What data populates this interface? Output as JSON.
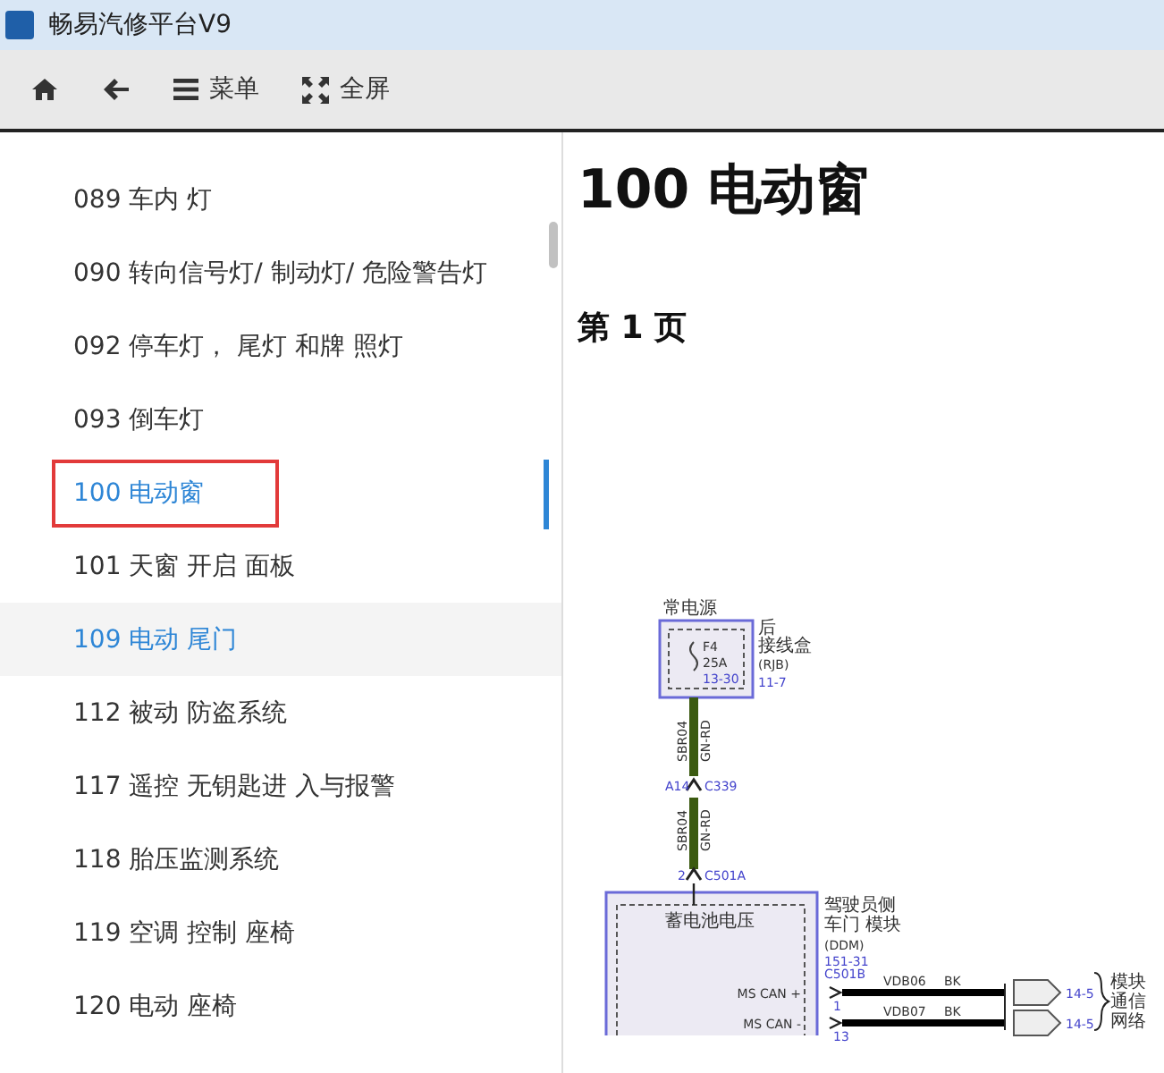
{
  "window": {
    "title": "畅易汽修平台V9"
  },
  "toolbar": [
    {
      "kind": "home"
    },
    {
      "kind": "back"
    },
    {
      "kind": "menu",
      "label": "菜单"
    },
    {
      "kind": "fullscreen",
      "label": "全屏"
    }
  ],
  "sidebar": {
    "items": [
      {
        "label": "089 车内 灯",
        "selected": false,
        "highlighted": false,
        "annotated": false
      },
      {
        "label": "090 转向信号灯/ 制动灯/ 危险警告灯",
        "selected": false,
        "highlighted": false,
        "annotated": false
      },
      {
        "label": "092 停车灯， 尾灯 和牌 照灯",
        "selected": false,
        "highlighted": false,
        "annotated": false
      },
      {
        "label": "093 倒车灯",
        "selected": false,
        "highlighted": false,
        "annotated": false
      },
      {
        "label": "100 电动窗",
        "selected": true,
        "highlighted": false,
        "annotated": true
      },
      {
        "label": "101 天窗 开启 面板",
        "selected": false,
        "highlighted": false,
        "annotated": false
      },
      {
        "label": "109 电动 尾门",
        "selected": false,
        "highlighted": true,
        "annotated": false
      },
      {
        "label": "112 被动 防盗系统",
        "selected": false,
        "highlighted": false,
        "annotated": false
      },
      {
        "label": "117 遥控 无钥匙进 入与报警",
        "selected": false,
        "highlighted": false,
        "annotated": false
      },
      {
        "label": "118 胎压监测系统",
        "selected": false,
        "highlighted": false,
        "annotated": false
      },
      {
        "label": "119 空调 控制 座椅",
        "selected": false,
        "highlighted": false,
        "annotated": false
      },
      {
        "label": "120 电动 座椅",
        "selected": false,
        "highlighted": false,
        "annotated": false
      }
    ]
  },
  "document": {
    "title": "100 电动窗",
    "page_label": "第 1 页",
    "diagram": {
      "supply_label": "常电源",
      "junction_box": {
        "name_lines": [
          "后",
          "接线盒",
          "(RJB)"
        ],
        "ref": "11-7"
      },
      "fuse": {
        "name": "F4",
        "rating": "25A",
        "ref": "13-30"
      },
      "wires": [
        {
          "circuit": "SBR04",
          "wire_code": "GN-RD"
        },
        {
          "circuit": "SBR04",
          "wire_code": "GN-RD"
        }
      ],
      "inline_connector": {
        "pin": "A14",
        "name": "C339"
      },
      "module_connector_top": {
        "pin": "2",
        "name": "C501A"
      },
      "module": {
        "name_lines": [
          "驾驶员侧",
          "车门 模块",
          "(DDM)"
        ],
        "ref": "151-31",
        "supply_label": "蓄电池电压"
      },
      "can_connector": "C501B",
      "can_lines": [
        {
          "signal": "MS CAN +",
          "pin": "1",
          "circuit": "VDB06",
          "wire_code": "BK",
          "ref": "14-5"
        },
        {
          "signal": "MS CAN -",
          "pin": "13",
          "circuit": "VDB07",
          "wire_code": "BK",
          "ref": "14-5"
        }
      ],
      "network_label": "模块通信网络"
    }
  }
}
